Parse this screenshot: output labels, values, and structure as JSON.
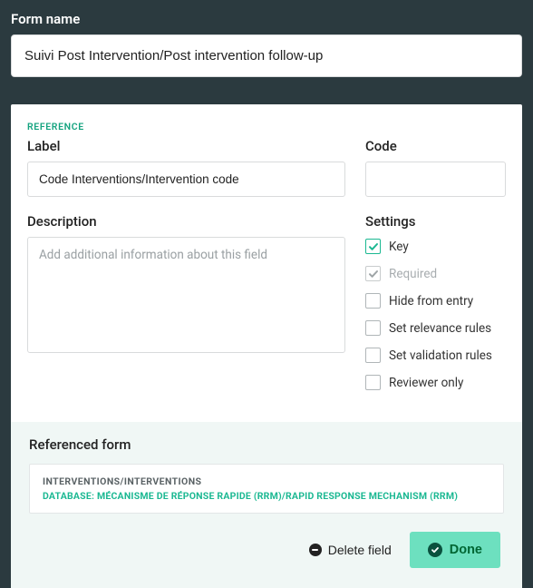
{
  "form_name_label": "Form name",
  "form_name_value": "Suivi Post Intervention/Post intervention follow-up",
  "section_tag": "REFERENCE",
  "label": {
    "title": "Label",
    "value": "Code Interventions/Intervention code"
  },
  "code": {
    "title": "Code",
    "value": ""
  },
  "description": {
    "title": "Description",
    "value": "",
    "placeholder": "Add additional information about this field"
  },
  "settings": {
    "title": "Settings",
    "options": [
      {
        "label": "Key",
        "checked": true,
        "disabled": false,
        "style": "teal"
      },
      {
        "label": "Required",
        "checked": true,
        "disabled": true,
        "style": "gray"
      },
      {
        "label": "Hide from entry",
        "checked": false,
        "disabled": false,
        "style": "plain"
      },
      {
        "label": "Set relevance rules",
        "checked": false,
        "disabled": false,
        "style": "plain"
      },
      {
        "label": "Set validation rules",
        "checked": false,
        "disabled": false,
        "style": "plain"
      },
      {
        "label": "Reviewer only",
        "checked": false,
        "disabled": false,
        "style": "plain"
      }
    ]
  },
  "referenced": {
    "title": "Referenced form",
    "line1": "INTERVENTIONS/INTERVENTIONS",
    "line2": "DATABASE: MÉCANISME DE RÉPONSE RAPIDE (RRM)/RAPID RESPONSE MECHANISM (RRM)"
  },
  "footer": {
    "delete_label": "Delete field",
    "done_label": "Done"
  }
}
